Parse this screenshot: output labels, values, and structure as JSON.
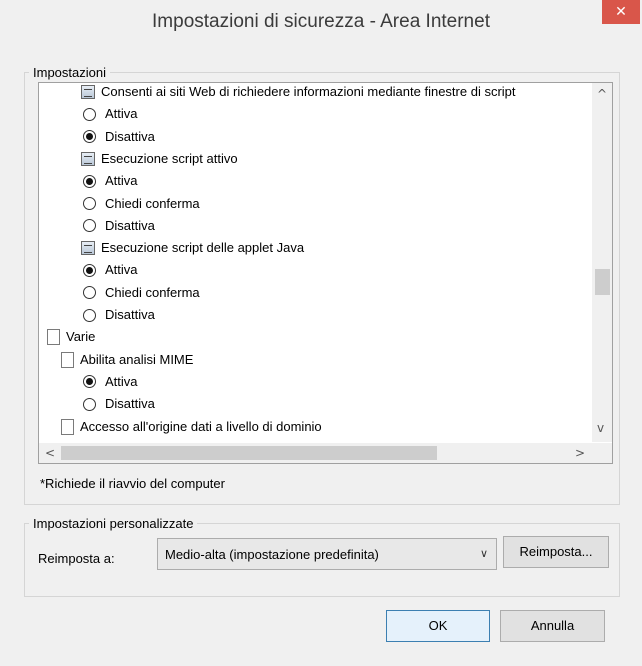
{
  "window": {
    "title": "Impostazioni di sicurezza - Area Internet",
    "close_glyph": "✕"
  },
  "settings_group": {
    "legend": "Impostazioni",
    "tree": [
      {
        "kind": "setting",
        "icon": "settings-icon",
        "label": "Consenti ai siti Web di richiedere informazioni mediante finestre di script"
      },
      {
        "kind": "option",
        "label": "Attiva",
        "checked": false
      },
      {
        "kind": "option",
        "label": "Disattiva",
        "checked": true
      },
      {
        "kind": "setting",
        "icon": "settings-icon",
        "label": "Esecuzione script attivo"
      },
      {
        "kind": "option",
        "label": "Attiva",
        "checked": true
      },
      {
        "kind": "option",
        "label": "Chiedi conferma",
        "checked": false
      },
      {
        "kind": "option",
        "label": "Disattiva",
        "checked": false
      },
      {
        "kind": "setting",
        "icon": "settings-icon",
        "label": "Esecuzione script delle applet Java"
      },
      {
        "kind": "option",
        "label": "Attiva",
        "checked": true
      },
      {
        "kind": "option",
        "label": "Chiedi conferma",
        "checked": false
      },
      {
        "kind": "option",
        "label": "Disattiva",
        "checked": false
      },
      {
        "kind": "category",
        "icon": "document-icon",
        "label": "Varie"
      },
      {
        "kind": "subsetting",
        "icon": "document-icon",
        "label": "Abilita analisi MIME"
      },
      {
        "kind": "option",
        "label": "Attiva",
        "checked": true
      },
      {
        "kind": "option",
        "label": "Disattiva",
        "checked": false
      },
      {
        "kind": "subsetting",
        "icon": "document-icon",
        "label": "Accesso all'origine dati a livello di dominio"
      }
    ],
    "scroll_up": "^",
    "scroll_down": "v",
    "scroll_left": "<",
    "scroll_right": ">",
    "note": "*Richiede il riavvio del computer"
  },
  "custom_group": {
    "legend": "Impostazioni personalizzate",
    "reset_label": "Reimposta a:",
    "select_value": "Medio-alta (impostazione predefinita)",
    "select_arrow": "∨",
    "reset_button": "Reimposta..."
  },
  "buttons": {
    "ok": "OK",
    "cancel": "Annulla"
  }
}
